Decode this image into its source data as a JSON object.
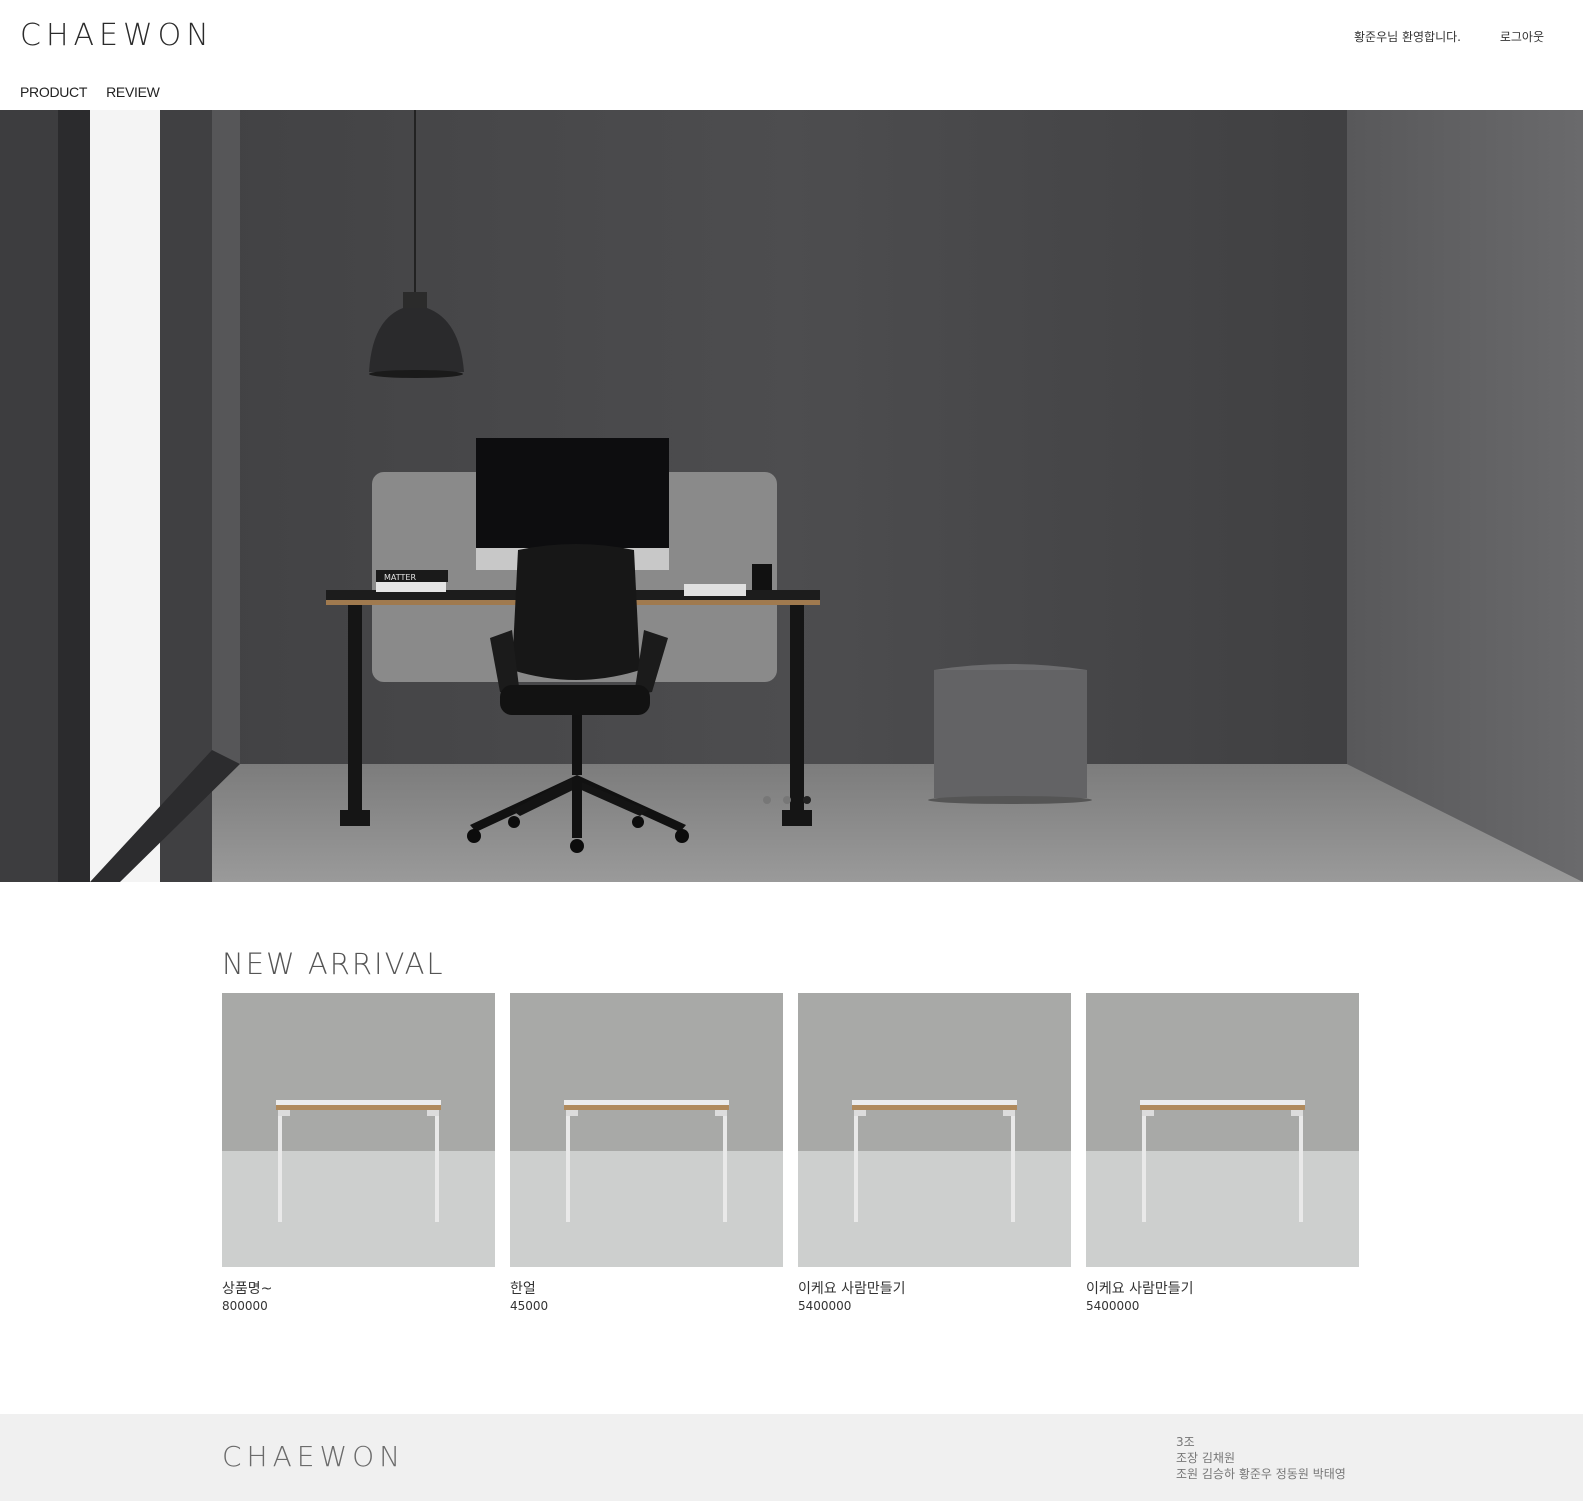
{
  "header": {
    "logo": "CHAEWON",
    "welcome": "황준우님 환영합니다.",
    "logout": "로그아웃",
    "nav": [
      {
        "label": "PRODUCT"
      },
      {
        "label": "REVIEW"
      }
    ]
  },
  "hero": {
    "slide_count": 3,
    "active_slide": 3,
    "book_text": "MATTER"
  },
  "new_arrival": {
    "title": "NEW ARRIVAL",
    "products": [
      {
        "name": "상품명~",
        "price": "800000"
      },
      {
        "name": "한얼",
        "price": "45000"
      },
      {
        "name": "이케요 사람만들기",
        "price": "5400000"
      },
      {
        "name": "이케요 사람만들기",
        "price": "5400000"
      }
    ]
  },
  "footer": {
    "logo": "CHAEWON",
    "team": "3조",
    "leader": "조장 김채원",
    "members": "조원 김승하 황준우 정동원 박태영"
  },
  "colors": {
    "hero_wall": "#4a4a4c",
    "footer_bg": "#f0f0f0",
    "thumb_wall": "#a8a9a7",
    "thumb_floor": "#cdcfce"
  }
}
